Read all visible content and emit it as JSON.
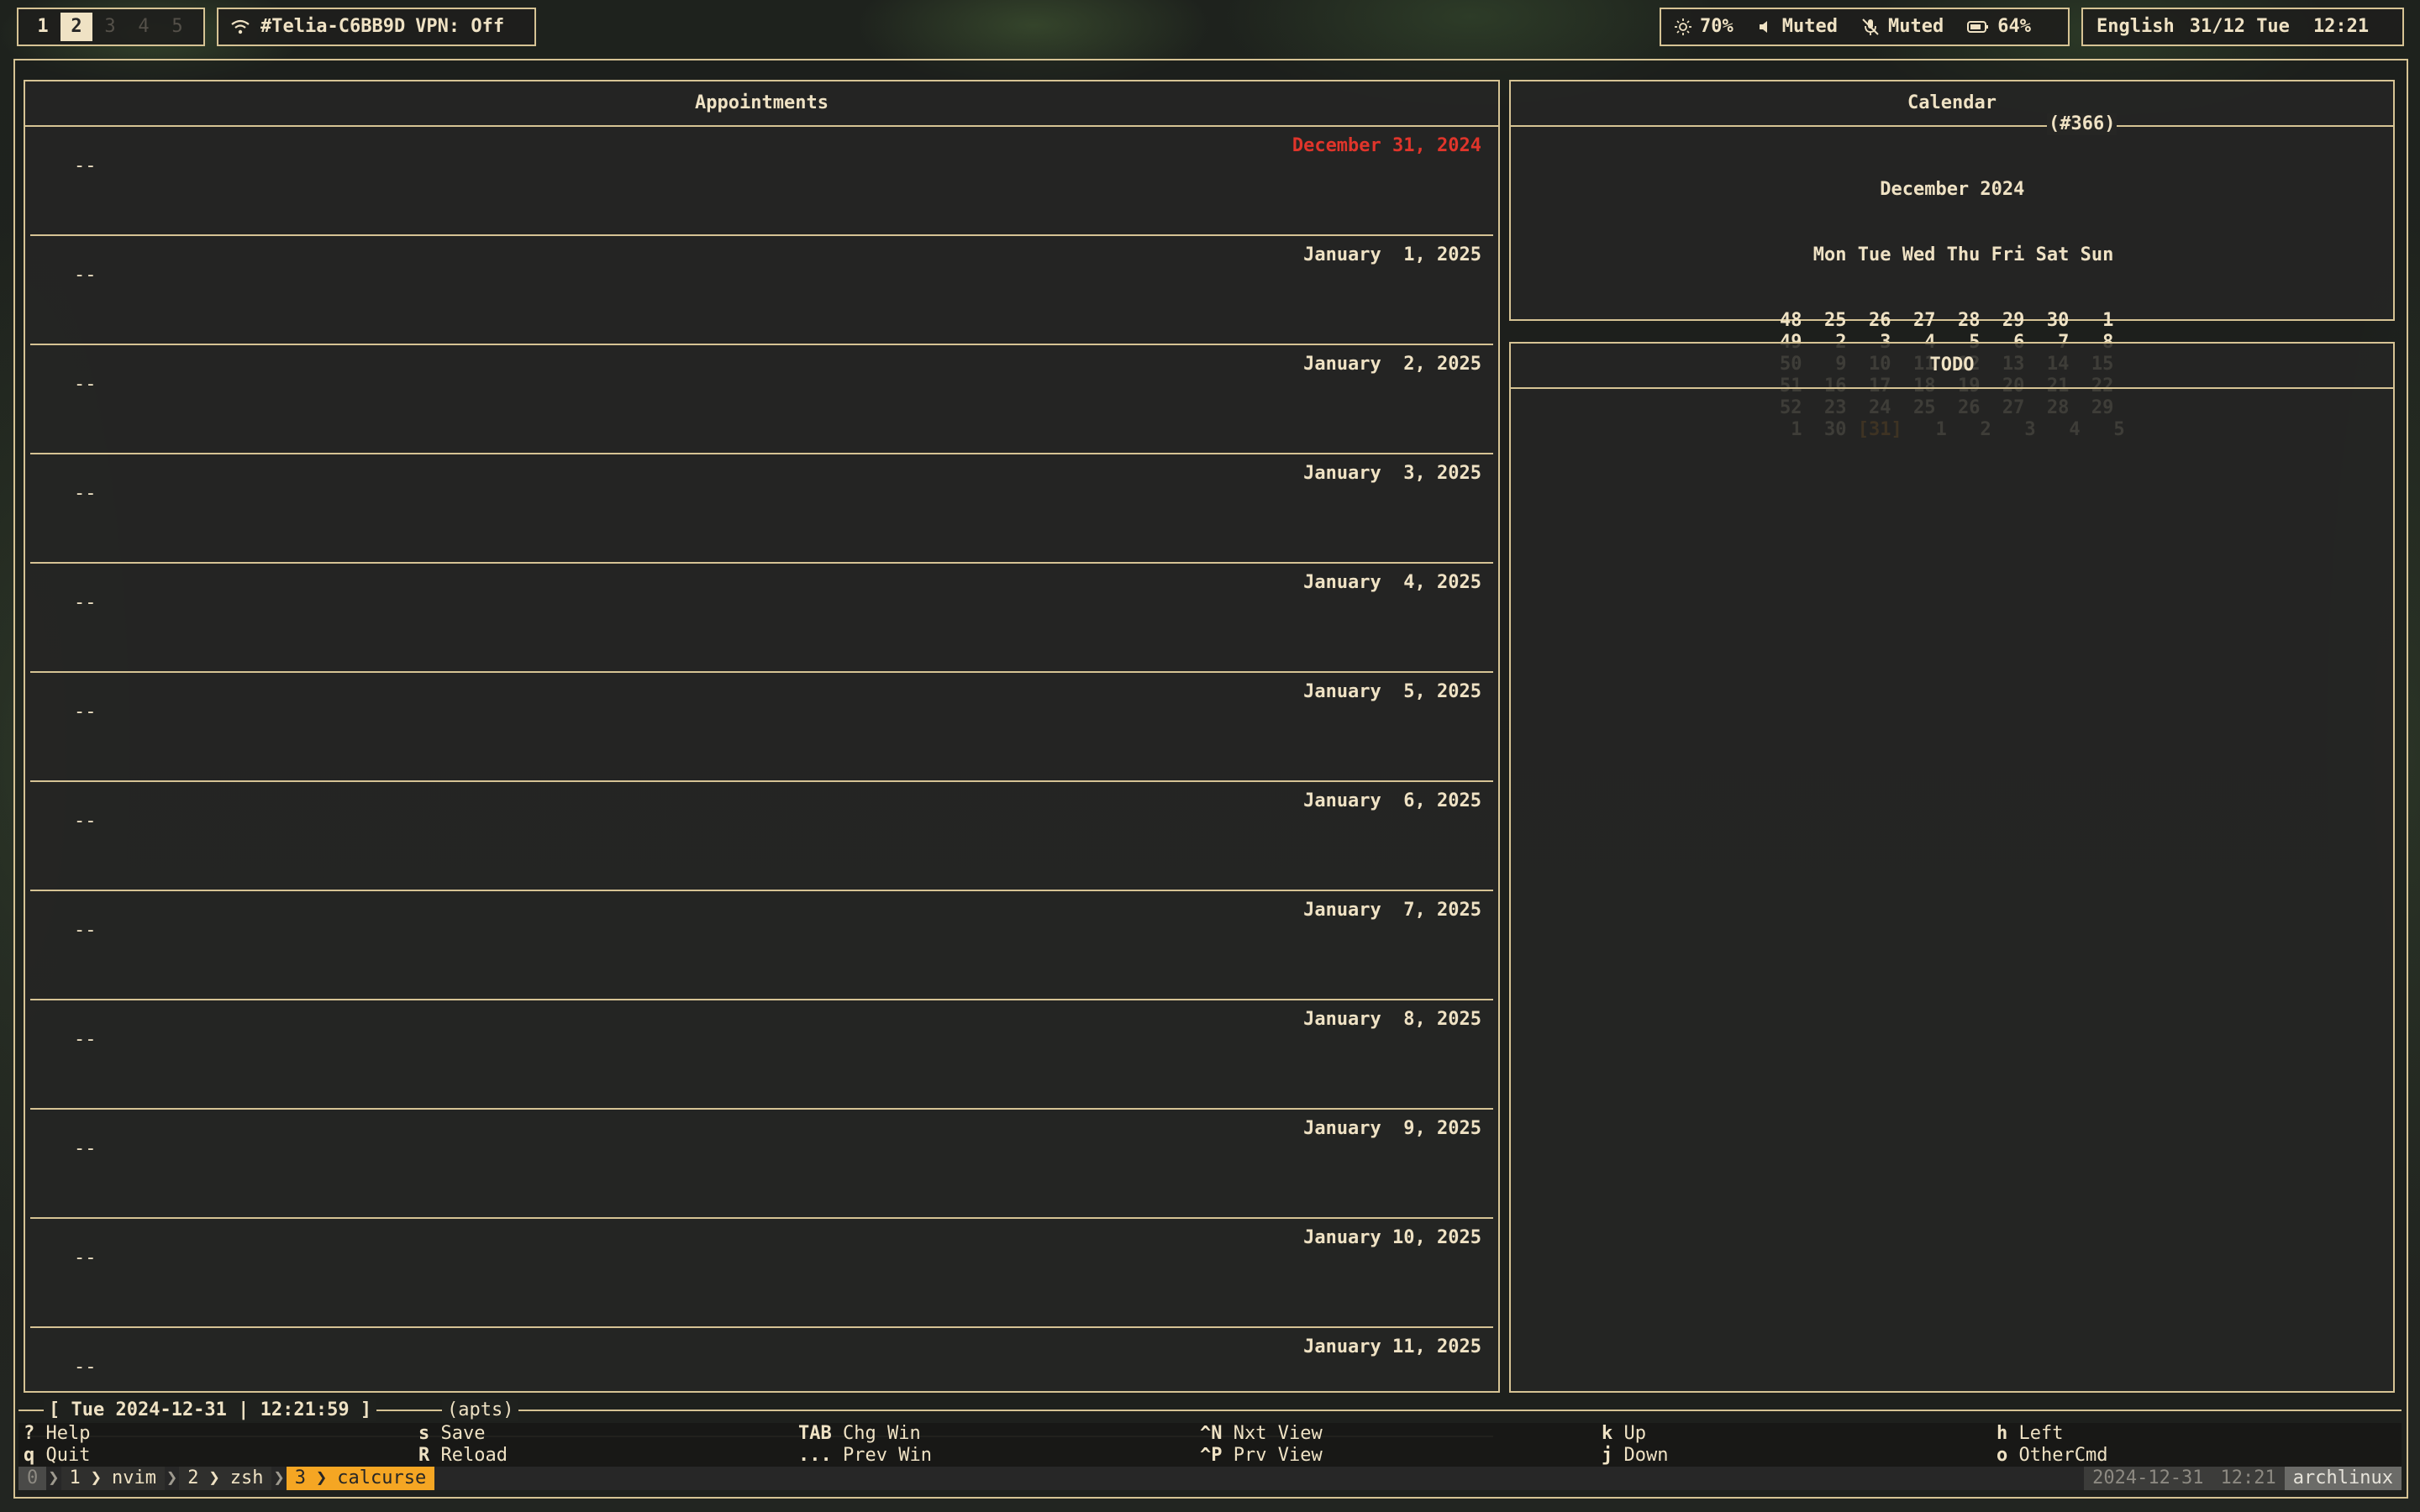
{
  "topbar": {
    "workspaces": [
      {
        "label": "1",
        "state": "normal"
      },
      {
        "label": "2",
        "state": "active"
      },
      {
        "label": "3",
        "state": "dim"
      },
      {
        "label": "4",
        "state": "dim"
      },
      {
        "label": "5",
        "state": "dim"
      }
    ],
    "wifi_icon": "wifi-icon",
    "network": "#Telia-C6BB9D",
    "vpn": "VPN: Off",
    "brightness": "70%",
    "volume": "Muted",
    "mic": "Muted",
    "battery": "64%",
    "language": "English",
    "date": "31/12 Tue",
    "time": "12:21"
  },
  "appointments": {
    "title": "Appointments",
    "days": [
      {
        "date": "December 31, 2024",
        "today": true,
        "entry": "--"
      },
      {
        "date": "January  1, 2025",
        "today": false,
        "entry": "--"
      },
      {
        "date": "January  2, 2025",
        "today": false,
        "entry": "--"
      },
      {
        "date": "January  3, 2025",
        "today": false,
        "entry": "--"
      },
      {
        "date": "January  4, 2025",
        "today": false,
        "entry": "--"
      },
      {
        "date": "January  5, 2025",
        "today": false,
        "entry": "--"
      },
      {
        "date": "January  6, 2025",
        "today": false,
        "entry": "--"
      },
      {
        "date": "January  7, 2025",
        "today": false,
        "entry": "--"
      },
      {
        "date": "January  8, 2025",
        "today": false,
        "entry": "--"
      },
      {
        "date": "January  9, 2025",
        "today": false,
        "entry": "--"
      },
      {
        "date": "January 10, 2025",
        "today": false,
        "entry": "--"
      },
      {
        "date": "January 11, 2025",
        "today": false,
        "entry": "--"
      }
    ]
  },
  "calendar": {
    "title": "Calendar",
    "day_count": "(#366)",
    "month": "December 2024",
    "header": "   Mon Tue Wed Thu Fri Sat Sun",
    "weeks": [
      {
        "week": "48",
        "days": [
          "25",
          "26",
          "27",
          "28",
          "29",
          "30",
          "1"
        ]
      },
      {
        "week": "49",
        "days": [
          "2",
          "3",
          "4",
          "5",
          "6",
          "7",
          "8"
        ]
      },
      {
        "week": "50",
        "days": [
          "9",
          "10",
          "11",
          "12",
          "13",
          "14",
          "15"
        ]
      },
      {
        "week": "51",
        "days": [
          "16",
          "17",
          "18",
          "19",
          "20",
          "21",
          "22"
        ]
      },
      {
        "week": "52",
        "days": [
          "23",
          "24",
          "25",
          "26",
          "27",
          "28",
          "29"
        ]
      },
      {
        "week": "1",
        "days": [
          "30",
          "[31]",
          "1",
          "2",
          "3",
          "4",
          "5"
        ]
      }
    ],
    "today_cell": "[31]",
    "today_color": "#e8921f"
  },
  "todo": {
    "title": "TODO"
  },
  "status_line": {
    "text": "[ Tue 2024-12-31 | 12:21:59 ]",
    "mode": "(apts)"
  },
  "keys": [
    {
      "key": "?",
      "label": "Help"
    },
    {
      "key": "q",
      "label": "Quit"
    },
    {
      "key": "s",
      "label": "Save"
    },
    {
      "key": "R",
      "label": "Reload"
    },
    {
      "key": "TAB",
      "label": "Chg Win"
    },
    {
      "key": "...",
      "label": "Prev Win"
    },
    {
      "key": "^N",
      "label": "Nxt View"
    },
    {
      "key": "^P",
      "label": "Prv View"
    },
    {
      "key": "k",
      "label": "Up"
    },
    {
      "key": "j",
      "label": "Down"
    },
    {
      "key": "h",
      "label": "Left"
    },
    {
      "key": "o",
      "label": "OtherCmd"
    }
  ],
  "tmux": {
    "session": "0",
    "windows": [
      {
        "index": "1",
        "name": "nvim",
        "active": false
      },
      {
        "index": "2",
        "name": "zsh",
        "active": false
      },
      {
        "index": "3",
        "name": "calcurse",
        "active": true
      }
    ],
    "date": "2024-12-31",
    "time": "12:21",
    "host": "archlinux"
  },
  "colors": {
    "fg": "#efe2c4",
    "border": "#d6c394",
    "today": "#e0352b",
    "tmux_active": "#f5a623"
  }
}
